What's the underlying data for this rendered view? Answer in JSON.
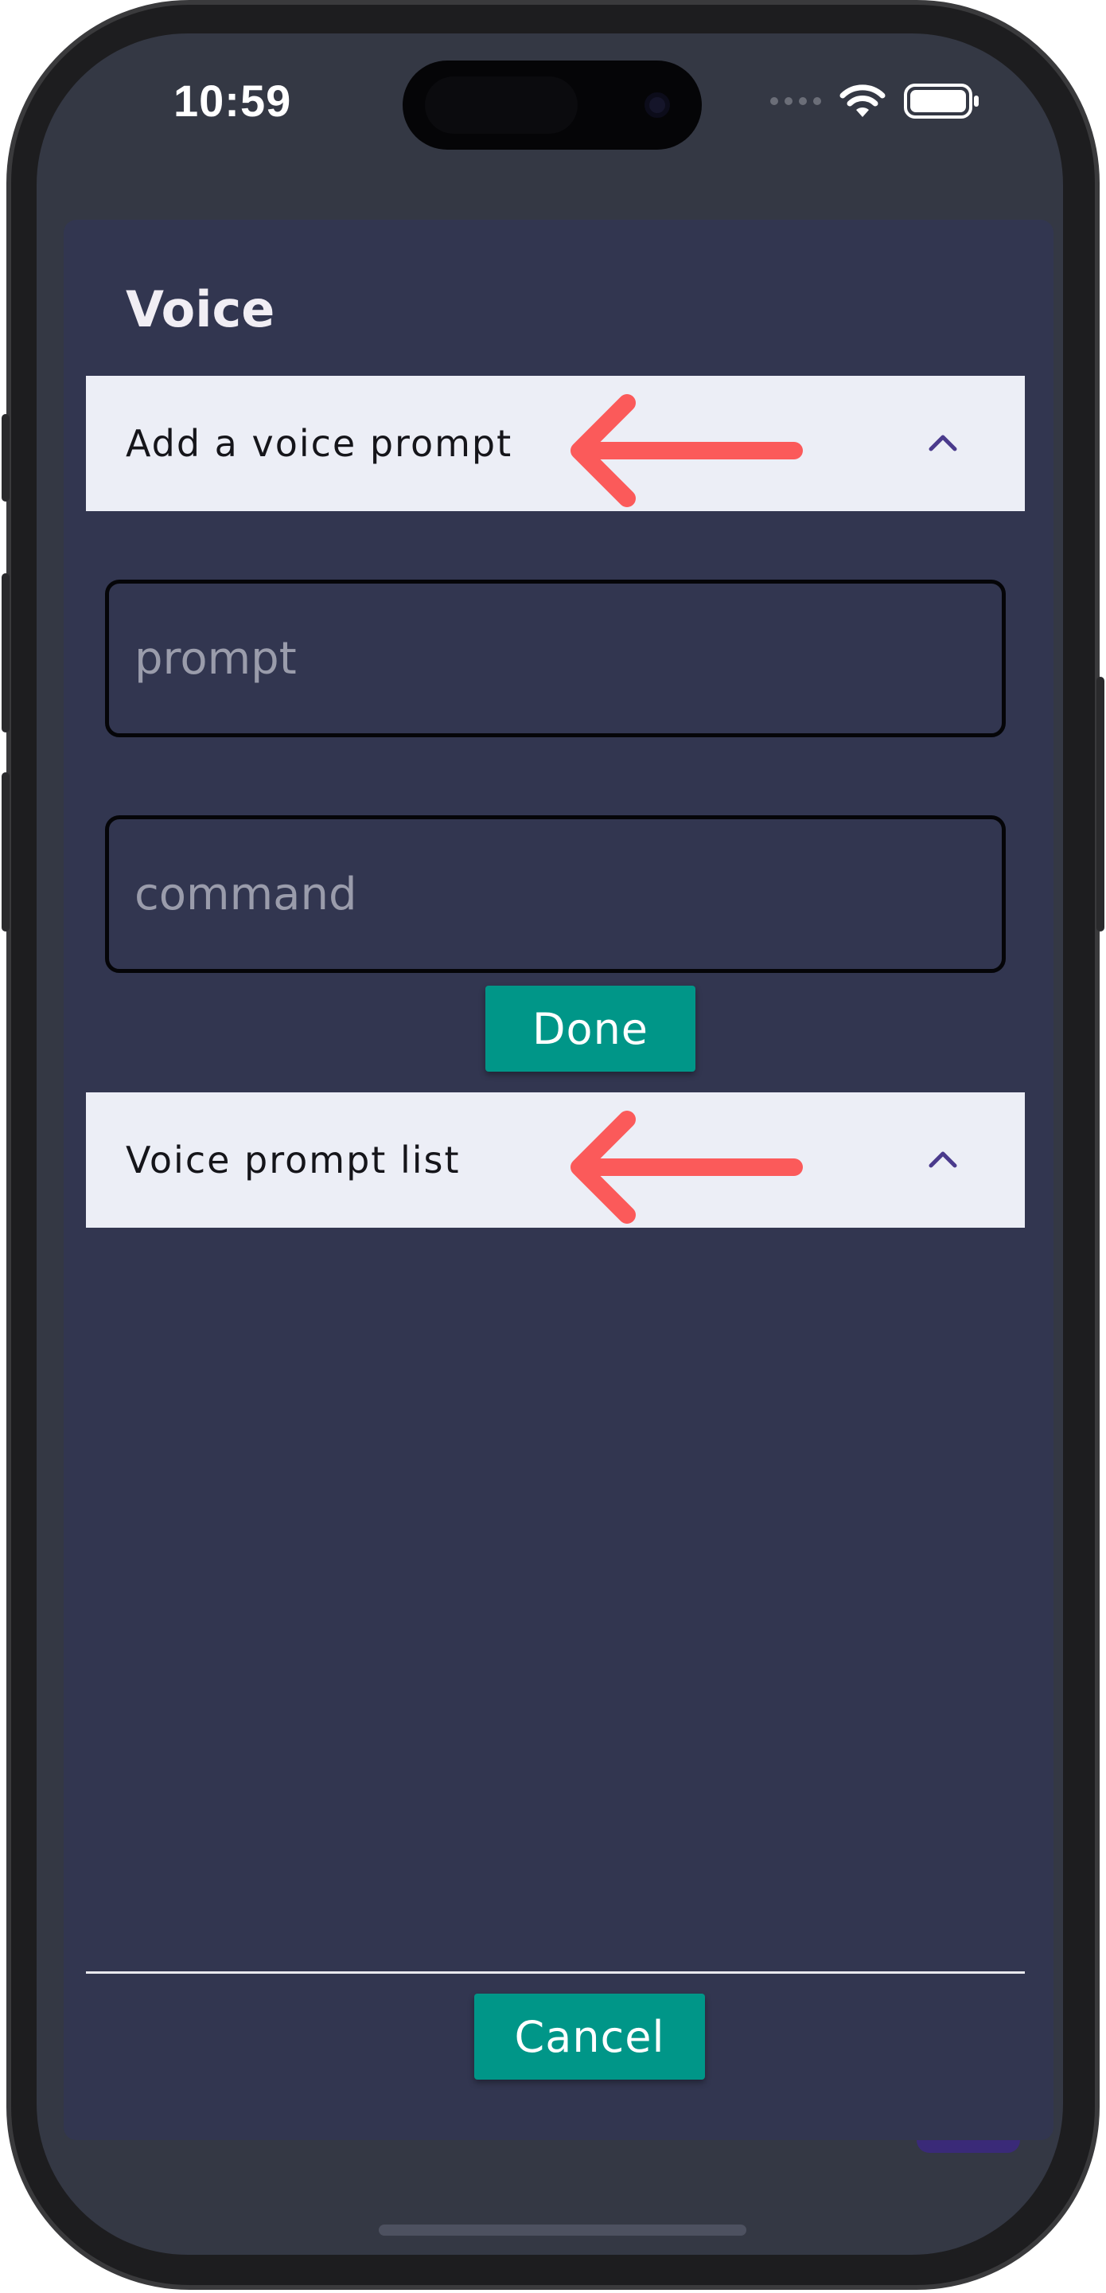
{
  "status_bar": {
    "time": "10:59"
  },
  "dialog": {
    "title": "Voice",
    "add_panel": {
      "label": "Add a voice prompt",
      "expanded": true
    },
    "prompt_field": {
      "value": "",
      "placeholder": "prompt"
    },
    "command_field": {
      "value": "",
      "placeholder": "command"
    },
    "done_button": "Done",
    "list_panel": {
      "label": "Voice prompt list",
      "expanded": true
    },
    "cancel_button": "Cancel"
  },
  "colors": {
    "dialog_bg": "#323650",
    "panel_header_bg": "#eceef6",
    "button_bg": "#009688",
    "chevron": "#4a3a8c",
    "annotation_arrow": "#fb5a5a"
  },
  "icons": {
    "chevron": "chevron-up-icon",
    "annotation": "arrow-left-icon"
  }
}
